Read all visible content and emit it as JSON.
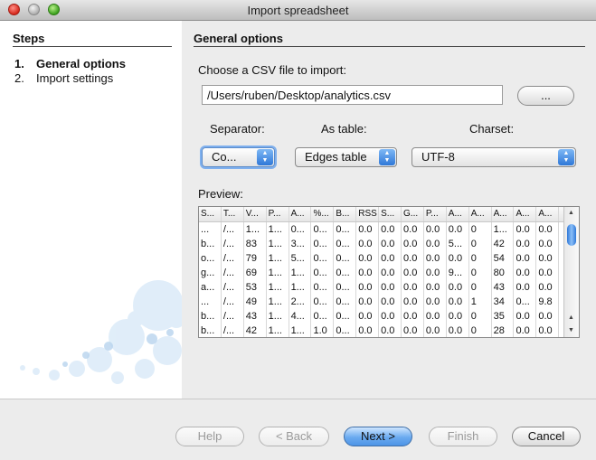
{
  "window": {
    "title": "Import spreadsheet"
  },
  "steps": {
    "heading": "Steps",
    "items": [
      {
        "num": "1.",
        "label": "General options"
      },
      {
        "num": "2.",
        "label": "Import settings"
      }
    ]
  },
  "main": {
    "section_title": "General options",
    "file_label": "Choose a CSV file to import:",
    "file_path": "/Users/ruben/Desktop/analytics.csv",
    "browse_label": "...",
    "separator_label": "Separator:",
    "separator_value": "Co...",
    "astable_label": "As table:",
    "astable_value": "Edges table",
    "charset_label": "Charset:",
    "charset_value": "UTF-8",
    "preview_label": "Preview:"
  },
  "preview": {
    "headers": [
      "S...",
      "T...",
      "V...",
      "P...",
      "A...",
      "%...",
      "B...",
      "RSS",
      "S...",
      "G...",
      "P...",
      "A...",
      "A...",
      "A...",
      "A...",
      "A..."
    ],
    "rows": [
      [
        "...",
        "/...",
        "1...",
        "1...",
        "0...",
        "0...",
        "0...",
        "0.0",
        "0.0",
        "0.0",
        "0.0",
        "0.0",
        "0",
        "1...",
        "0.0",
        "0.0"
      ],
      [
        "b...",
        "/...",
        "83",
        "1...",
        "3...",
        "0...",
        "0...",
        "0.0",
        "0.0",
        "0.0",
        "0.0",
        "5...",
        "0",
        "42",
        "0.0",
        "0.0"
      ],
      [
        "o...",
        "/...",
        "79",
        "1...",
        "5...",
        "0...",
        "0...",
        "0.0",
        "0.0",
        "0.0",
        "0.0",
        "0.0",
        "0",
        "54",
        "0.0",
        "0.0"
      ],
      [
        "g...",
        "/...",
        "69",
        "1...",
        "1...",
        "0...",
        "0...",
        "0.0",
        "0.0",
        "0.0",
        "0.0",
        "9...",
        "0",
        "80",
        "0.0",
        "0.0"
      ],
      [
        "a...",
        "/...",
        "53",
        "1...",
        "1...",
        "0...",
        "0...",
        "0.0",
        "0.0",
        "0.0",
        "0.0",
        "0.0",
        "0",
        "43",
        "0.0",
        "0.0"
      ],
      [
        "...",
        "/...",
        "49",
        "1...",
        "2...",
        "0...",
        "0...",
        "0.0",
        "0.0",
        "0.0",
        "0.0",
        "0.0",
        "1",
        "34",
        "0...",
        "9.8"
      ],
      [
        "b...",
        "/...",
        "43",
        "1...",
        "4...",
        "0...",
        "0...",
        "0.0",
        "0.0",
        "0.0",
        "0.0",
        "0.0",
        "0",
        "35",
        "0.0",
        "0.0"
      ],
      [
        "b...",
        "/...",
        "42",
        "1...",
        "1...",
        "1.0",
        "0...",
        "0.0",
        "0.0",
        "0.0",
        "0.0",
        "0.0",
        "0",
        "28",
        "0.0",
        "0.0"
      ]
    ]
  },
  "footer": {
    "help": "Help",
    "back": "< Back",
    "next": "Next >",
    "finish": "Finish",
    "cancel": "Cancel"
  }
}
